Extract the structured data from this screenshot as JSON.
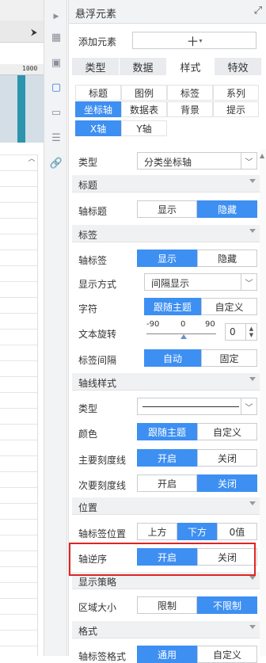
{
  "left": {
    "ruler_value": "1000"
  },
  "panel": {
    "title": "悬浮元素",
    "add_label": "添加元素",
    "tabs": [
      "类型",
      "数据",
      "样式",
      "特效"
    ],
    "sub_tabs_row1": [
      "标题",
      "图例",
      "标签",
      "系列"
    ],
    "sub_tabs_row2": [
      "坐标轴",
      "数据表",
      "背景",
      "提示"
    ],
    "axis_tabs": [
      "X轴",
      "Y轴"
    ],
    "type_label": "类型",
    "type_value": "分类坐标轴",
    "sections": {
      "title": "标题",
      "label": "标签",
      "axis_style": "轴线样式",
      "position": "位置",
      "display": "显示策略",
      "format": "格式"
    },
    "axis_title": {
      "label": "轴标题",
      "options": [
        "显示",
        "隐藏"
      ]
    },
    "axis_label": {
      "label": "轴标签",
      "options": [
        "显示",
        "隐藏"
      ]
    },
    "display_mode": {
      "label": "显示方式",
      "value": "间隔显示"
    },
    "font": {
      "label": "字符",
      "options": [
        "跟随主题",
        "自定义"
      ]
    },
    "rotation": {
      "label": "文本旋转",
      "ticks": [
        "-90",
        "0",
        "90"
      ],
      "value": "0"
    },
    "label_interval": {
      "label": "标签间隔",
      "options": [
        "自动",
        "固定"
      ]
    },
    "line_type": {
      "label": "类型"
    },
    "line_color": {
      "label": "颜色",
      "options": [
        "跟随主题",
        "自定义"
      ]
    },
    "major_tick": {
      "label": "主要刻度线",
      "options": [
        "开启",
        "关闭"
      ]
    },
    "minor_tick": {
      "label": "次要刻度线",
      "options": [
        "开启",
        "关闭"
      ]
    },
    "label_position": {
      "label": "轴标签位置",
      "options": [
        "上方",
        "下方",
        "0值"
      ]
    },
    "reverse": {
      "label": "轴逆序",
      "options": [
        "开启",
        "关闭"
      ]
    },
    "area_size": {
      "label": "区域大小",
      "options": [
        "限制",
        "不限制"
      ]
    },
    "label_format": {
      "label": "轴标签格式",
      "options": [
        "通用",
        "自定义"
      ]
    }
  },
  "colors": {
    "accent": "#3d8ff2",
    "highlight": "#e02424"
  }
}
